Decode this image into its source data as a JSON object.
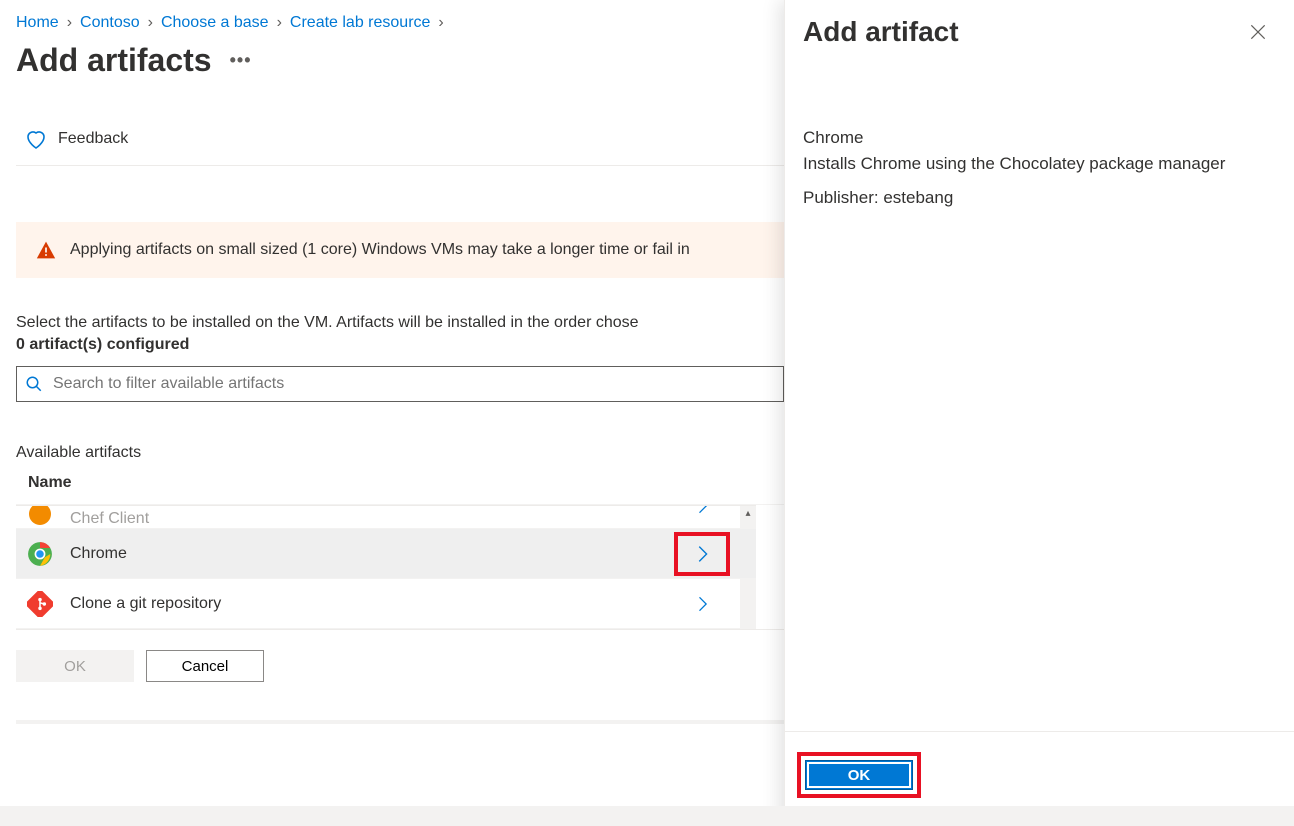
{
  "breadcrumb": {
    "items": [
      "Home",
      "Contoso",
      "Choose a base",
      "Create lab resource"
    ]
  },
  "page": {
    "title": "Add artifacts",
    "feedback": "Feedback",
    "warning": "Applying artifacts on small sized (1 core) Windows VMs may take a longer time or fail in",
    "select_text": "Select the artifacts to be installed on the VM. Artifacts will be installed in the order chose",
    "configured": "0 artifact(s) configured",
    "search_placeholder": "Search to filter available artifacts",
    "available_label": "Available artifacts",
    "name_header": "Name",
    "ok": "OK",
    "cancel": "Cancel"
  },
  "artifacts": {
    "partial_top": "Chef Client",
    "row1": "Chrome",
    "row2": "Clone a git repository"
  },
  "panel": {
    "title": "Add artifact",
    "name": "Chrome",
    "description": "Installs Chrome using the Chocolatey package manager",
    "publisher": "Publisher: estebang",
    "ok": "OK"
  }
}
